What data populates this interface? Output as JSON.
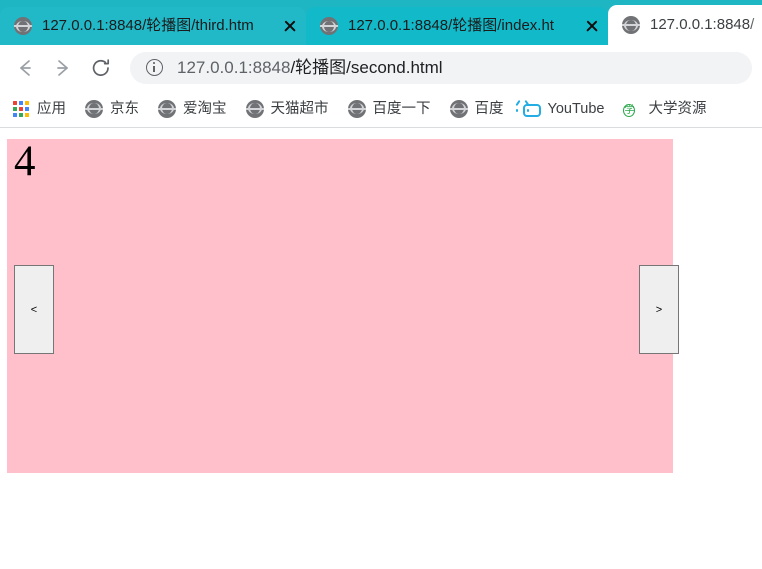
{
  "browser": {
    "tabs": [
      {
        "title": "127.0.0.1:8848/轮播图/third.htm",
        "favicon": "globe-icon",
        "active": false,
        "close_label": "×"
      },
      {
        "title": "127.0.0.1:8848/轮播图/index.ht",
        "favicon": "globe-icon",
        "active": false,
        "close_label": "×"
      },
      {
        "title": "127.0.0.1:8848/",
        "favicon": "globe-icon",
        "active": true,
        "close_label": "×"
      }
    ],
    "toolbar": {
      "back_label": "back-arrow",
      "forward_label": "forward-arrow",
      "reload_label": "reload-arrow",
      "omnibox": {
        "security_icon": "info-circle-icon",
        "url_host": "127.0.0.1:8848",
        "url_path": "/轮播图/second.html",
        "url_full": "127.0.0.1:8848/轮播图/second.html"
      }
    },
    "bookmarks": [
      {
        "label": "应用",
        "icon": "apps-grid-icon"
      },
      {
        "label": "京东",
        "icon": "globe-icon"
      },
      {
        "label": "爱淘宝",
        "icon": "globe-icon"
      },
      {
        "label": "天猫超市",
        "icon": "globe-icon"
      },
      {
        "label": "百度一下",
        "icon": "globe-icon"
      },
      {
        "label": "百度",
        "icon": "globe-icon"
      },
      {
        "label": "YouTube",
        "icon": "tv-icon"
      },
      {
        "label": "大学资源",
        "icon": "glyph-circle-icon",
        "glyph": "学"
      }
    ]
  },
  "page": {
    "carousel": {
      "slide_number": "4",
      "background_color": "#ffc0cb",
      "prev_label": "<",
      "next_label": ">"
    }
  }
}
